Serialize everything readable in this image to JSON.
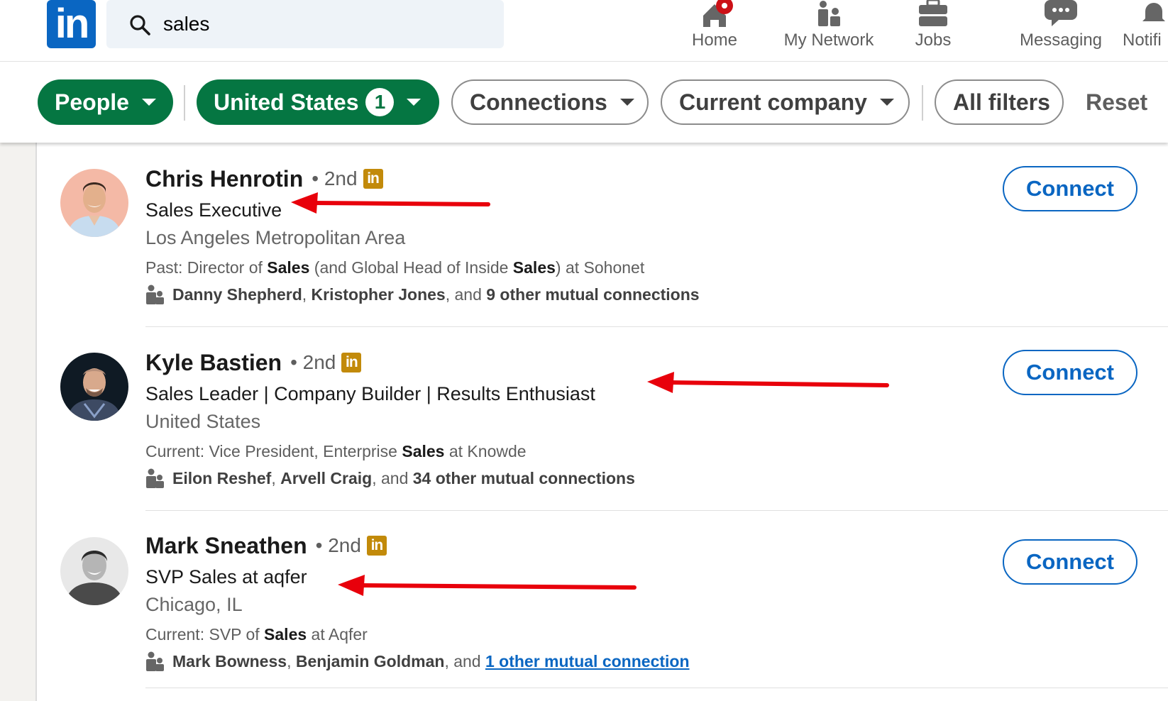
{
  "nav": {
    "logo_text": "in",
    "search": {
      "value": "sales",
      "placeholder": "Search"
    },
    "items": [
      {
        "label": "Home",
        "icon": "home-icon"
      },
      {
        "label": "My Network",
        "icon": "network-icon"
      },
      {
        "label": "Jobs",
        "icon": "briefcase-icon"
      },
      {
        "label": "Messaging",
        "icon": "messaging-icon"
      },
      {
        "label": "Notifi",
        "icon": "bell-icon"
      }
    ],
    "accent_color": "#0a66c2",
    "notification_dot_color": "#cc1016"
  },
  "filters": {
    "people": "People",
    "united_states": "United States",
    "united_states_count": "1",
    "connections": "Connections",
    "current_company": "Current company",
    "all_filters": "All filters",
    "reset": "Reset",
    "active_color": "#057642"
  },
  "results": [
    {
      "name": "Chris Henrotin",
      "degree": "• 2nd",
      "badge": "in",
      "headline": "Sales Executive",
      "location": "Los Angeles Metropolitan Area",
      "summary_prefix": "Past: Director of ",
      "summary_b1": "Sales",
      "summary_mid": " (and Global Head of Inside ",
      "summary_b2": "Sales",
      "summary_suffix": ") at Sohonet",
      "mutual_name1": "Danny Shepherd",
      "mutual_sep": ", ",
      "mutual_name2": "Kristopher Jones",
      "mutual_and": ", and ",
      "mutual_more": "9 other mutual connections",
      "connect": "Connect"
    },
    {
      "name": "Kyle Bastien",
      "degree": "• 2nd",
      "badge": "in",
      "headline": "Sales Leader | Company Builder | Results Enthusiast",
      "location": "United States",
      "summary_prefix": "Current: Vice President, Enterprise ",
      "summary_b1": "Sales",
      "summary_suffix": " at Knowde",
      "mutual_name1": "Eilon Reshef",
      "mutual_sep": ", ",
      "mutual_name2": "Arvell Craig",
      "mutual_and": ", and ",
      "mutual_more": "34 other mutual connections",
      "connect": "Connect"
    },
    {
      "name": "Mark Sneathen",
      "degree": "• 2nd",
      "badge": "in",
      "headline": "SVP Sales at aqfer",
      "location": "Chicago, IL",
      "summary_prefix": "Current: SVP of ",
      "summary_b1": "Sales",
      "summary_suffix": " at Aqfer",
      "mutual_name1": "Mark Bowness",
      "mutual_sep": ", ",
      "mutual_name2": "Benjamin Goldman",
      "mutual_and": ", and ",
      "mutual_more": "1 other mutual connection",
      "connect": "Connect"
    }
  ],
  "annotation_color": "#e8000b"
}
